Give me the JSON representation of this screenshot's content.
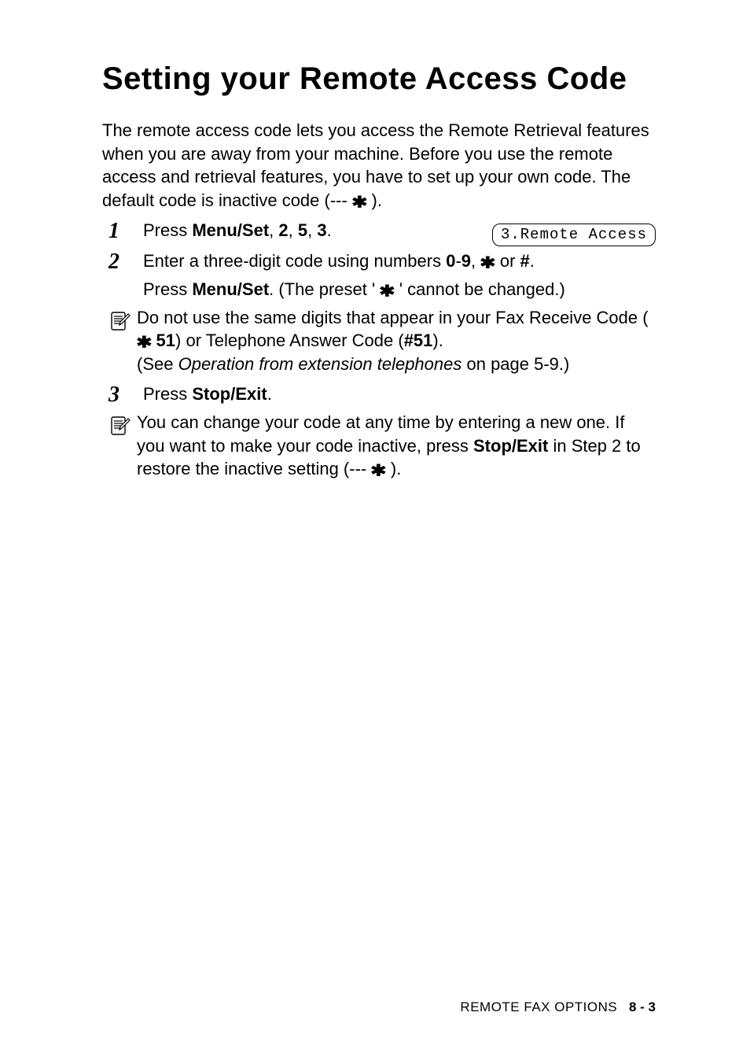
{
  "title": "Setting your Remote Access Code",
  "intro_before": "The remote access code lets you access the Remote Retrieval features when you are away from your machine. Before you use the remote access and retrieval features, you have to set up your own code. The default code is inactive code (--- ",
  "intro_after": " ).",
  "steps": {
    "s1": {
      "num": "1",
      "t1": "Press ",
      "b1": "Menu/Set",
      "t2": ", ",
      "b2": "2",
      "t3": ", ",
      "b3": "5",
      "t4": ", ",
      "b4": "3",
      "t5": "."
    },
    "s2": {
      "num": "2",
      "line1_a": "Enter a three-digit code using numbers ",
      "line1_b": "0",
      "line1_c": "-",
      "line1_d": "9",
      "line1_e": ",  ",
      "line1_f": "  or ",
      "line1_g": "#",
      "line1_h": ".",
      "line2_a": "Press ",
      "line2_b": "Menu/Set",
      "line2_c": ". (The preset ' ",
      "line2_d": " ' cannot be changed.)"
    },
    "s3": {
      "num": "3",
      "t1": "Press ",
      "b1": "Stop/Exit",
      "t2": "."
    }
  },
  "display": "3.Remote Access",
  "note1": {
    "l1a": "Do not use the same digits that appear in your Fax Receive Code ( ",
    "l1b": " 51",
    "l1c": ") or Telephone Answer Code (",
    "l1d": "#51",
    "l1e": ").",
    "l2a": "(See ",
    "l2b": "Operation from extension telephones",
    "l2c": " on page 5-9.)"
  },
  "note2": {
    "a": "You can change your code at any time by entering a new one. If you want to make your code inactive, press ",
    "b": "Stop/Exit",
    "c": " in Step 2 to restore the inactive setting (--- ",
    "d": " )."
  },
  "footer": {
    "section": "REMOTE FAX OPTIONS",
    "page": "8 - 3"
  },
  "star": "✱"
}
